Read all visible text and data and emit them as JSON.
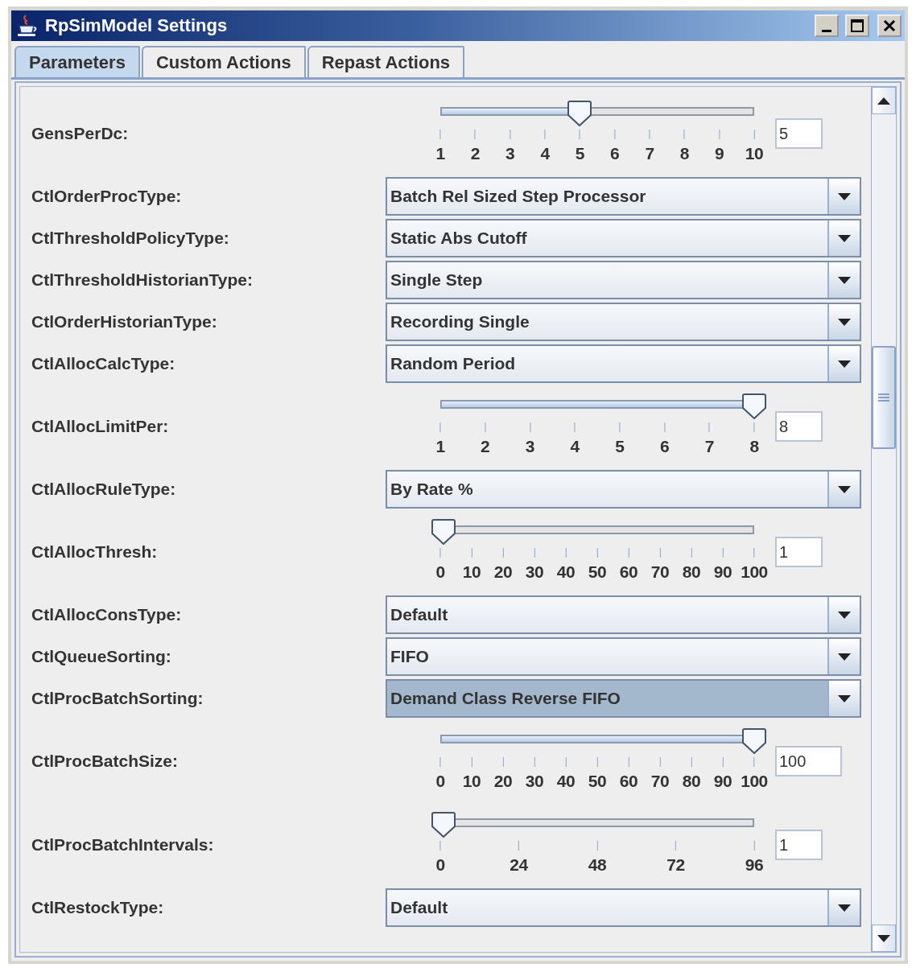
{
  "window": {
    "title": "RpSimModel Settings"
  },
  "tabs": [
    {
      "label": "Parameters",
      "selected": true
    },
    {
      "label": "Custom Actions",
      "selected": false
    },
    {
      "label": "Repast Actions",
      "selected": false
    }
  ],
  "rows": [
    {
      "kind": "slider",
      "label": "GensPerDc:",
      "ticks": [
        "1",
        "2",
        "3",
        "4",
        "5",
        "6",
        "7",
        "8",
        "9",
        "10"
      ],
      "level": 0.444,
      "value": "5"
    },
    {
      "kind": "combo",
      "label": "CtlOrderProcType:",
      "value": "Batch Rel Sized Step Processor",
      "focused": false
    },
    {
      "kind": "combo",
      "label": "CtlThresholdPolicyType:",
      "value": "Static Abs Cutoff",
      "focused": false
    },
    {
      "kind": "combo",
      "label": "CtlThresholdHistorianType:",
      "value": "Single Step",
      "focused": false
    },
    {
      "kind": "combo",
      "label": "CtlOrderHistorianType:",
      "value": "Recording Single",
      "focused": false
    },
    {
      "kind": "combo",
      "label": "CtlAllocCalcType:",
      "value": "Random Period",
      "focused": false
    },
    {
      "kind": "slider",
      "label": "CtlAllocLimitPer:",
      "ticks": [
        "1",
        "2",
        "3",
        "4",
        "5",
        "6",
        "7",
        "8"
      ],
      "level": 1,
      "value": "8"
    },
    {
      "kind": "combo",
      "label": "CtlAllocRuleType:",
      "value": "By Rate %",
      "focused": false
    },
    {
      "kind": "slider",
      "label": "CtlAllocThresh:",
      "ticks": [
        "0",
        "10",
        "20",
        "30",
        "40",
        "50",
        "60",
        "70",
        "80",
        "90",
        "100"
      ],
      "level": 0.01,
      "value": "1"
    },
    {
      "kind": "combo",
      "label": "CtlAllocConsType:",
      "value": "Default",
      "focused": false
    },
    {
      "kind": "combo",
      "label": "CtlQueueSorting:",
      "value": "FIFO",
      "focused": false
    },
    {
      "kind": "combo",
      "label": "CtlProcBatchSorting:",
      "value": "Demand Class Reverse FIFO",
      "focused": true
    },
    {
      "kind": "slider",
      "label": "CtlProcBatchSize:",
      "ticks": [
        "0",
        "10",
        "20",
        "30",
        "40",
        "50",
        "60",
        "70",
        "80",
        "90",
        "100"
      ],
      "level": 1,
      "value": "100"
    },
    {
      "kind": "slider",
      "label": "CtlProcBatchIntervals:",
      "ticks": [
        "0",
        "24",
        "48",
        "72",
        "96"
      ],
      "level": 0.01,
      "value": "1"
    },
    {
      "kind": "combo",
      "label": "CtlRestockType:",
      "value": "Default",
      "focused": false
    }
  ]
}
